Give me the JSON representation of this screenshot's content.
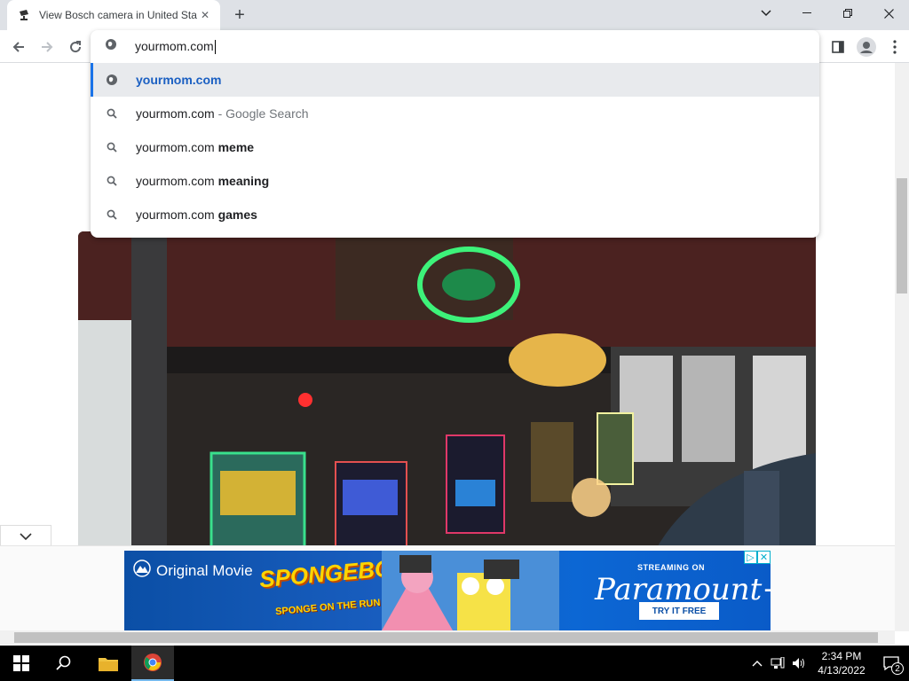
{
  "tab": {
    "title": "View Bosch camera in United States"
  },
  "omnibox": {
    "input_value": "yourmom.com",
    "suggestions": [
      {
        "main": "yourmom.com",
        "suffix": "",
        "icon": "globe-icon"
      },
      {
        "main": "yourmom.com",
        "suffix": " - Google Search",
        "icon": "search-icon"
      },
      {
        "main": "yourmom.com ",
        "suffix": "meme",
        "icon": "search-icon"
      },
      {
        "main": "yourmom.com ",
        "suffix": "meaning",
        "icon": "search-icon"
      },
      {
        "main": "yourmom.com ",
        "suffix": "games",
        "icon": "search-icon"
      }
    ]
  },
  "ad": {
    "original_movie": "Original Movie",
    "movie_title": "SPONGEBOB",
    "movie_subtitle": "SPONGE ON THE RUN",
    "streaming_on": "STREAMING ON",
    "brand": "Paramount+",
    "cta": "TRY IT FREE"
  },
  "taskbar": {
    "time": "2:34 PM",
    "date": "4/13/2022",
    "notification_count": "2"
  }
}
